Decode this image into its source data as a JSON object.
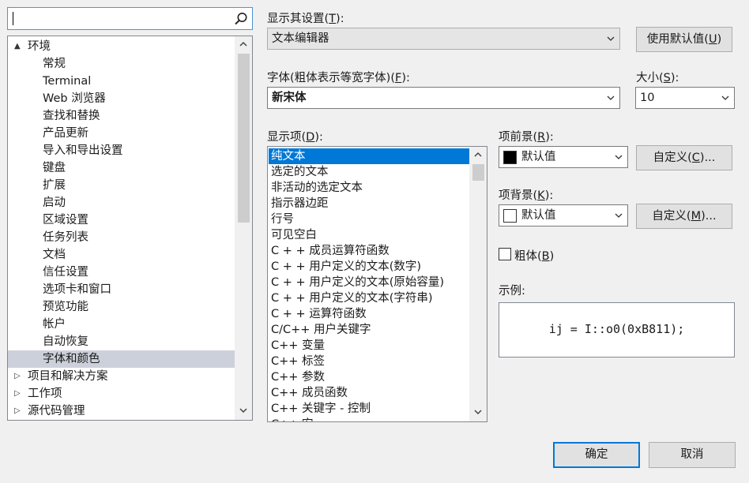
{
  "search": {
    "value": ""
  },
  "tree": {
    "items": [
      {
        "label": "环境",
        "twisty": "▲",
        "level": 0,
        "selected": false
      },
      {
        "label": "常规",
        "level": 1
      },
      {
        "label": "Terminal",
        "level": 1
      },
      {
        "label": "Web 浏览器",
        "level": 1
      },
      {
        "label": "查找和替换",
        "level": 1
      },
      {
        "label": "产品更新",
        "level": 1
      },
      {
        "label": "导入和导出设置",
        "level": 1
      },
      {
        "label": "键盘",
        "level": 1
      },
      {
        "label": "扩展",
        "level": 1
      },
      {
        "label": "启动",
        "level": 1
      },
      {
        "label": "区域设置",
        "level": 1
      },
      {
        "label": "任务列表",
        "level": 1
      },
      {
        "label": "文档",
        "level": 1
      },
      {
        "label": "信任设置",
        "level": 1
      },
      {
        "label": "选项卡和窗口",
        "level": 1
      },
      {
        "label": "预览功能",
        "level": 1
      },
      {
        "label": "帐户",
        "level": 1
      },
      {
        "label": "自动恢复",
        "level": 1
      },
      {
        "label": "字体和颜色",
        "level": 1,
        "selected": true
      },
      {
        "label": "项目和解决方案",
        "twisty": "▷",
        "level": 0
      },
      {
        "label": "工作项",
        "twisty": "▷",
        "level": 0
      },
      {
        "label": "源代码管理",
        "twisty": "▷",
        "level": 0
      }
    ]
  },
  "show_settings_for": {
    "label": "显示其设置(",
    "accel": "T",
    "label_end": "):",
    "value": "文本编辑器"
  },
  "use_defaults_button": {
    "label": "使用默认值(",
    "accel": "U",
    "label_end": ")"
  },
  "font": {
    "label": "字体(粗体表示等宽字体)(",
    "accel": "F",
    "label_end": "):",
    "value": "新宋体"
  },
  "size": {
    "label": "大小(",
    "accel": "S",
    "label_end": "):",
    "value": "10"
  },
  "display_items": {
    "label": "显示项(",
    "accel": "D",
    "label_end": "):",
    "items": [
      "纯文本",
      "选定的文本",
      "非活动的选定文本",
      "指示器边距",
      "行号",
      "可见空白",
      "C + + 成员运算符函数",
      "C + + 用户定义的文本(数字)",
      "C + + 用户定义的文本(原始容量)",
      "C + + 用户定义的文本(字符串)",
      "C + + 运算符函数",
      "C/C++ 用户关键字",
      "C++ 变量",
      "C++ 标签",
      "C++ 参数",
      "C++ 成员函数",
      "C++ 关键字 - 控制",
      "C++ 宏"
    ],
    "selected_index": 0
  },
  "foreground": {
    "label": "项前景(",
    "accel": "R",
    "label_end": "):",
    "value": "默认值",
    "swatch_color": "#000000",
    "custom_button": {
      "label": "自定义(",
      "accel": "C",
      "label_end": ")..."
    }
  },
  "background": {
    "label": "项背景(",
    "accel": "K",
    "label_end": "):",
    "value": "默认值",
    "swatch_color": "#ffffff",
    "custom_button": {
      "label": "自定义(",
      "accel": "M",
      "label_end": ")..."
    }
  },
  "bold": {
    "label": "粗体(",
    "accel": "B",
    "label_end": ")",
    "checked": false
  },
  "sample": {
    "label": "示例:",
    "code": "ij = I::o0(0xB811);"
  },
  "ok_button": {
    "label": "确定"
  },
  "cancel_button": {
    "label": "取消"
  },
  "colors": {
    "selection_blue": "#0078d7",
    "tree_selection": "#ccd0da",
    "dialog_bg": "#f0f0f0"
  }
}
